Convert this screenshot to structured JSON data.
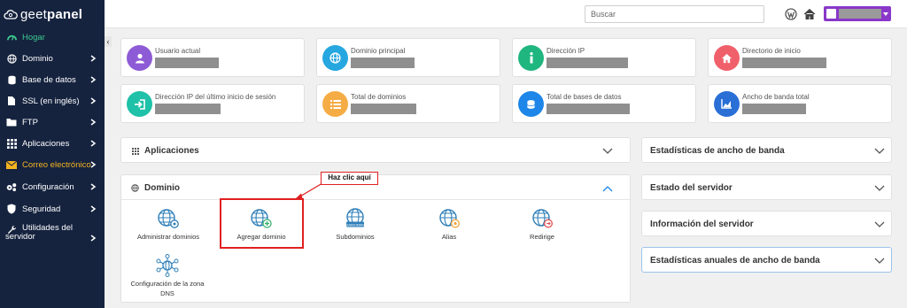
{
  "brand": {
    "name_light": "geet",
    "name_bold": "panel"
  },
  "sidebar": {
    "items": [
      {
        "label": "Hogar",
        "icon": "dashboard-icon"
      },
      {
        "label": "Dominio",
        "icon": "globe-icon"
      },
      {
        "label": "Base de datos",
        "icon": "database-icon"
      },
      {
        "label": "SSL (en inglés)",
        "icon": "file-icon"
      },
      {
        "label": "FTP",
        "icon": "folder-icon"
      },
      {
        "label": "Aplicaciones",
        "icon": "grid-icon"
      },
      {
        "label": "Correo electrónico",
        "icon": "envelope-icon"
      },
      {
        "label": "Configuración",
        "icon": "cogs-icon"
      },
      {
        "label": "Seguridad",
        "icon": "shield-icon"
      },
      {
        "label_line1": "Utilidades del",
        "label_line2": "servidor",
        "icon": "wrench-icon"
      }
    ],
    "colors": {
      "bg": "#15233f",
      "active": "#3ec98f",
      "highlight": "#f5b321"
    }
  },
  "topbar": {
    "search_placeholder": "Buscar",
    "user_color": "#8a38c9"
  },
  "cards": [
    {
      "label": "Usuario actual",
      "color": "#8e5bd6",
      "icon": "user-icon"
    },
    {
      "label": "Dominio principal",
      "color": "#26a7e0",
      "icon": "globe-icon"
    },
    {
      "label": "Dirección IP",
      "color": "#1fb67f",
      "icon": "info-icon"
    },
    {
      "label": "Directorio de inicio",
      "color": "#f0606b",
      "icon": "home-icon"
    },
    {
      "label": "Dirección IP del último inicio de sesión",
      "color": "#1fc1a8",
      "icon": "sign-in-icon"
    },
    {
      "label": "Total de dominios",
      "color": "#f6ac45",
      "icon": "list-icon"
    },
    {
      "label": "Total de bases de datos",
      "color": "#1d86e8",
      "icon": "database-icon"
    },
    {
      "label": "Ancho de banda total",
      "color": "#2a6fd6",
      "icon": "chart-icon"
    }
  ],
  "panels": {
    "apps_title": "Aplicaciones",
    "domain_title": "Dominio",
    "domain_items": [
      {
        "label": "Administrar dominios",
        "icon": "manage-domains-icon"
      },
      {
        "label": "Agregar dominio",
        "icon": "add-domain-icon"
      },
      {
        "label": "Subdominios",
        "icon": "subdomains-icon"
      },
      {
        "label": "Alias",
        "icon": "alias-icon"
      },
      {
        "label": "Redirige",
        "icon": "redirect-icon"
      },
      {
        "label_line1": "Configuración de la zona",
        "label_line2": "DNS",
        "icon": "dns-zone-icon"
      }
    ],
    "subdomain_badge": "SUBDOMAIN",
    "right": [
      {
        "title": "Estadísticas de ancho de banda"
      },
      {
        "title": "Estado del servidor"
      },
      {
        "title": "Información del servidor"
      },
      {
        "title": "Estadísticas anuales de ancho de banda"
      }
    ]
  },
  "annotation": {
    "callout": "Haz clic aquí",
    "color": "#e02020"
  }
}
